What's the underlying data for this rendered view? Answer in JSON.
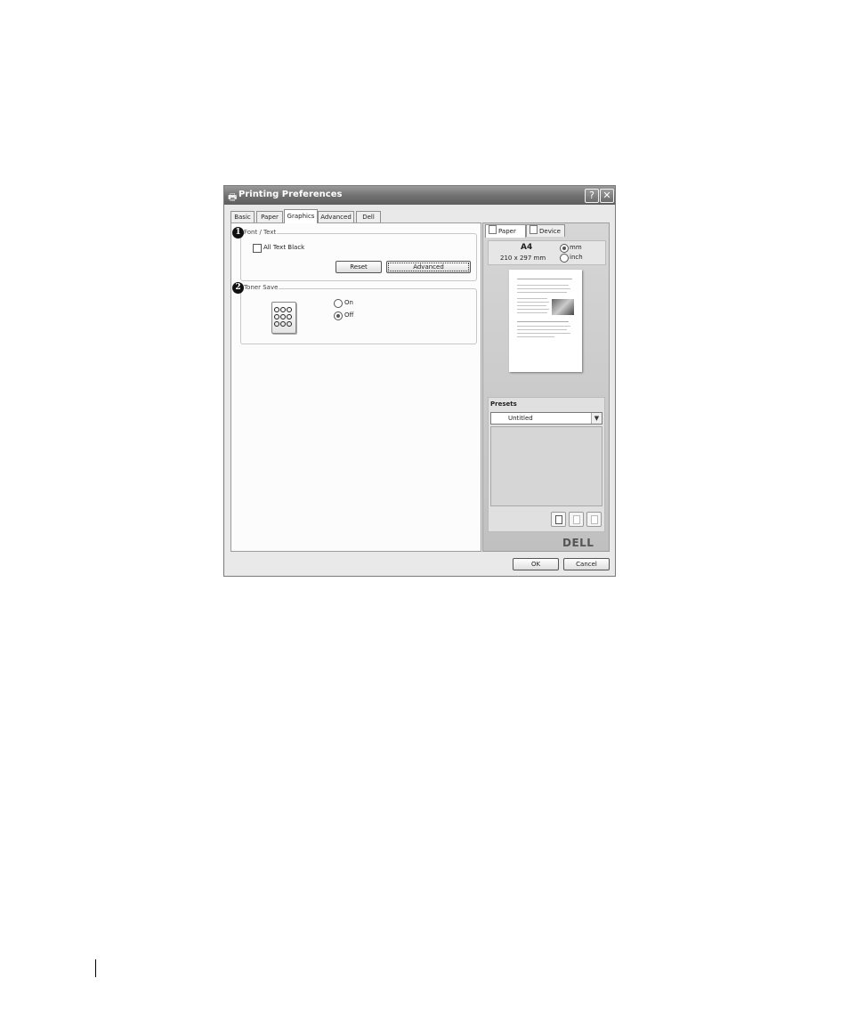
{
  "window": {
    "title": "Printing Preferences",
    "help_button": "?",
    "close_button": "✕"
  },
  "tabs": [
    "Basic",
    "Paper",
    "Graphics",
    "Advanced",
    "Dell"
  ],
  "active_tab": "Graphics",
  "font_text": {
    "badge": "1",
    "group_label": "Font / Text",
    "all_text_black_label": "All Text Black",
    "all_text_black_checked": false,
    "reset_button": "Reset",
    "advanced_button": "Advanced"
  },
  "toner_save": {
    "badge": "2",
    "group_label": "Toner Save",
    "options": [
      {
        "label": "On",
        "selected": false
      },
      {
        "label": "Off",
        "selected": true
      }
    ]
  },
  "side_panel": {
    "tabs": [
      "Paper",
      "Device"
    ],
    "active_tab": "Paper",
    "paper_size": "A4",
    "paper_dimensions": "210 x 297 mm",
    "units": [
      {
        "label": "mm",
        "selected": true
      },
      {
        "label": "inch",
        "selected": false
      }
    ],
    "presets_label": "Presets",
    "preset_selected": "Untitled",
    "logo": "DELL"
  },
  "footer": {
    "ok_button": "OK",
    "cancel_button": "Cancel"
  },
  "colors": {
    "titlebar": "#6f6f6f",
    "dialog_bg": "#e9e9e9",
    "panel_bg": "#fcfcfc"
  }
}
